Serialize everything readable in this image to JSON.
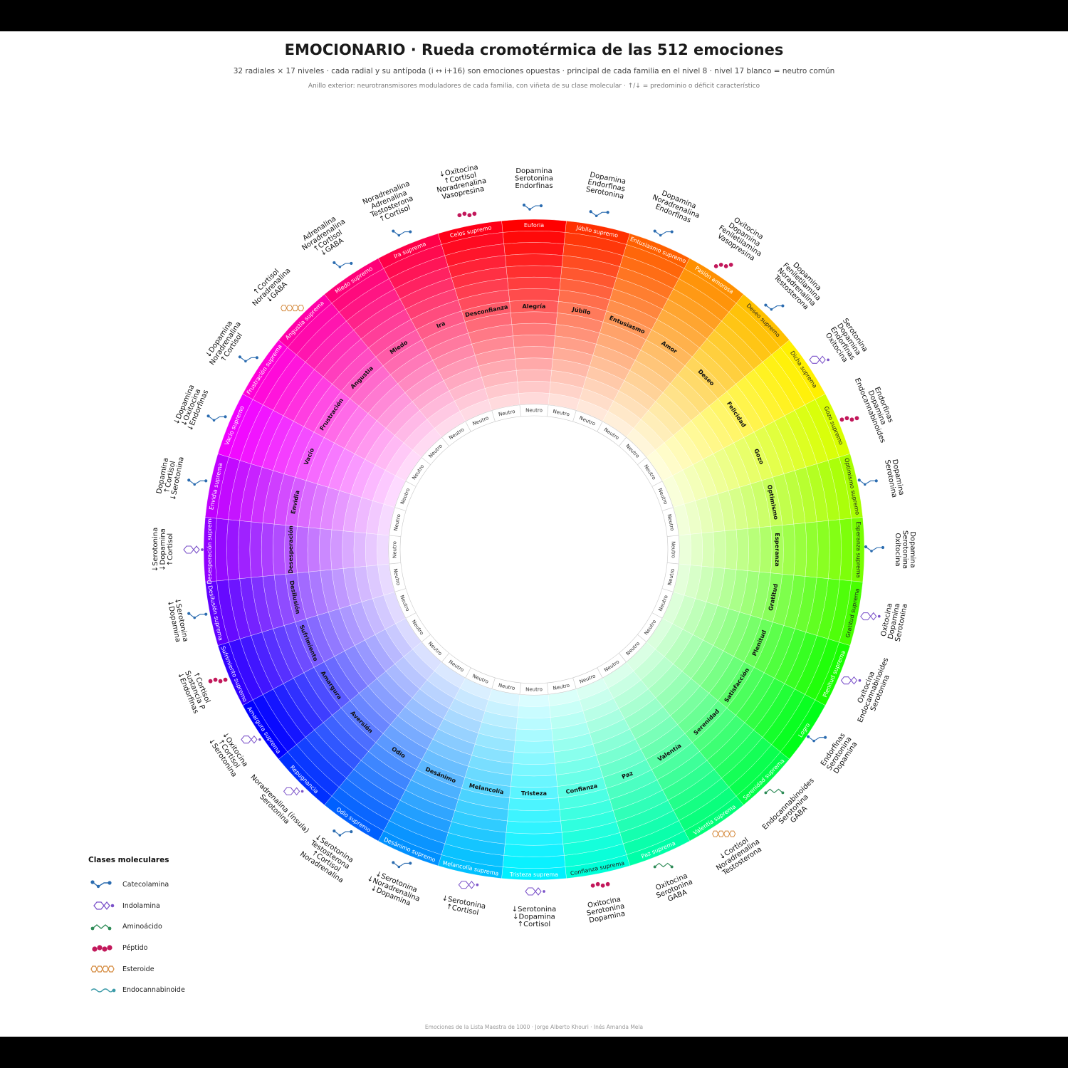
{
  "header": {
    "title": "EMOCIONARIO · Rueda cromotérmica de las 512 emociones",
    "subtitle": "32 radiales × 17 niveles · cada radial y su antípoda (i ↔ i+16) son emociones opuestas · principal de cada familia en el nivel 8 · nivel 17 blanco = neutro común",
    "note": "Anillo exterior: neurotransmisores moduladores de cada familia, con viñeta de su clase molecular · ↑/↓ = predominio o déficit característico"
  },
  "wheel": {
    "families": [
      {
        "principal": "Alegría",
        "outer": "Euforia",
        "inner": "Neutro",
        "color": "#ff0000",
        "neuro": [
          "Endorfinas",
          "Serotonina",
          "Dopamina"
        ],
        "cls": "catecolamina"
      },
      {
        "principal": "Júbilo",
        "outer": "Júbilo supremo",
        "inner": "Neutro",
        "color": "#ff3000",
        "neuro": [
          "Serotonina",
          "Endorfinas",
          "Dopamina"
        ],
        "cls": "catecolamina"
      },
      {
        "principal": "Entusiasmo",
        "outer": "Entusiasmo supremo",
        "inner": "Neutro",
        "color": "#ff6000",
        "neuro": [
          "Endorfinas",
          "Noradrenalina",
          "Dopamina"
        ],
        "cls": "catecolamina"
      },
      {
        "principal": "Amor",
        "outer": "Pasión amorosa",
        "inner": "Neutro",
        "color": "#ff9000",
        "neuro": [
          "Vasopresina",
          "Feniletilamina",
          "Dopamina",
          "Oxitocina"
        ],
        "cls": "peptido"
      },
      {
        "principal": "Deseo",
        "outer": "Deseo supremo",
        "inner": "Neutro",
        "color": "#ffc000",
        "neuro": [
          "Testosterona",
          "Noradrenalina",
          "Feniletilamina",
          "Dopamina"
        ],
        "cls": "catecolamina"
      },
      {
        "principal": "Felicidad",
        "outer": "Dicha suprema",
        "inner": "Neutro",
        "color": "#fff000",
        "neuro": [
          "Oxitocina",
          "Endorfinas",
          "Dopamina",
          "Serotonina"
        ],
        "cls": "indolamina"
      },
      {
        "principal": "Gozo",
        "outer": "Gozo supremo",
        "inner": "Neutro",
        "color": "#d8ff00",
        "neuro": [
          "Endocannabinoides",
          "Dopamina",
          "Endorfinas"
        ],
        "cls": "peptido"
      },
      {
        "principal": "Optimismo",
        "outer": "Optimismo supremo",
        "inner": "Neutro",
        "color": "#a8ff00",
        "neuro": [
          "Serotonina",
          "Dopamina"
        ],
        "cls": "catecolamina"
      },
      {
        "principal": "Esperanza",
        "outer": "Esperanza suprema",
        "inner": "Neutro",
        "color": "#78ff00",
        "neuro": [
          "Oxitocina",
          "Serotonina",
          "Dopamina"
        ],
        "cls": "catecolamina"
      },
      {
        "principal": "Gratitud",
        "outer": "Gratitud suprema",
        "inner": "Neutro",
        "color": "#48ff00",
        "neuro": [
          "Oxitocina",
          "Dopamina",
          "Serotonina"
        ],
        "cls": "indolamina"
      },
      {
        "principal": "Plenitud",
        "outer": "Plenitud suprema",
        "inner": "Neutro",
        "color": "#18ff00",
        "neuro": [
          "Oxitocina",
          "Endocannabinoides",
          "Serotonina"
        ],
        "cls": "indolamina"
      },
      {
        "principal": "Satisfacción",
        "outer": "Logro",
        "inner": "Neutro",
        "color": "#00ff18",
        "neuro": [
          "Endorfinas",
          "Serotonina",
          "Dopamina"
        ],
        "cls": "catecolamina"
      },
      {
        "principal": "Serenidad",
        "outer": "Serenidad suprema",
        "inner": "Neutro",
        "color": "#00ff48",
        "neuro": [
          "Endocannabinoides",
          "Serotonina",
          "GABA"
        ],
        "cls": "aminoacido"
      },
      {
        "principal": "Valentía",
        "outer": "Valentía suprema",
        "inner": "Neutro",
        "color": "#00ff78",
        "neuro": [
          "↓Cortisol",
          "Noradrenalina",
          "Testosterona"
        ],
        "cls": "esteroide"
      },
      {
        "principal": "Paz",
        "outer": "Paz suprema",
        "inner": "Neutro",
        "color": "#00ffa8",
        "neuro": [
          "Oxitocina",
          "Serotonina",
          "GABA"
        ],
        "cls": "aminoacido"
      },
      {
        "principal": "Confianza",
        "outer": "Confianza suprema",
        "inner": "Neutro",
        "color": "#00ffd8",
        "neuro": [
          "Oxitocina",
          "Serotonina",
          "Dopamina"
        ],
        "cls": "peptido"
      },
      {
        "principal": "Tristeza",
        "outer": "Tristeza suprema",
        "inner": "Neutro",
        "color": "#00f0ff",
        "neuro": [
          "↓Serotonina",
          "↓Dopamina",
          "↑Cortisol"
        ],
        "cls": "indolamina"
      },
      {
        "principal": "Melancolía",
        "outer": "Melancolía suprema",
        "inner": "Neutro",
        "color": "#00c0ff",
        "neuro": [
          "↓Serotonina",
          "↑Cortisol"
        ],
        "cls": "indolamina"
      },
      {
        "principal": "Desánimo",
        "outer": "Desánimo supremo",
        "inner": "Neutro",
        "color": "#0090ff",
        "neuro": [
          "↓Serotonina",
          "↓Noradrenalina",
          "↓Dopamina"
        ],
        "cls": "catecolamina"
      },
      {
        "principal": "Odio",
        "outer": "Odio supremo",
        "inner": "Neutro",
        "color": "#0060ff",
        "neuro": [
          "↓Serotonina",
          "Testosterona",
          "↑Cortisol",
          "Noradrenalina"
        ],
        "cls": "catecolamina"
      },
      {
        "principal": "Aversión",
        "outer": "Repugnancia",
        "inner": "Neutro",
        "color": "#0030ff",
        "neuro": [
          "Noradrenalina (ínsula)",
          "Serotonina"
        ],
        "cls": "indolamina"
      },
      {
        "principal": "Amargura",
        "outer": "Amargura suprema",
        "inner": "Neutro",
        "color": "#0000ff",
        "neuro": [
          "↓Oxitocina",
          "↑Cortisol",
          "↓Serotonina"
        ],
        "cls": "indolamina"
      },
      {
        "principal": "Sufrimiento",
        "outer": "Sufrimiento supremo",
        "inner": "Neutro",
        "color": "#3000ff",
        "neuro": [
          "↑Cortisol",
          "Sustancia P",
          "↓Endorfinas"
        ],
        "cls": "peptido"
      },
      {
        "principal": "Desilusión",
        "outer": "Desilusión suprema",
        "inner": "Neutro",
        "color": "#6000ff",
        "neuro": [
          "↓Serotonina",
          "↓Dopamina"
        ],
        "cls": "catecolamina"
      },
      {
        "principal": "Desesperación",
        "outer": "Desesperación suprema",
        "inner": "Neutro",
        "color": "#9000ff",
        "neuro": [
          "↑Cortisol",
          "↓Dopamina",
          "↓Serotonina"
        ],
        "cls": "indolamina"
      },
      {
        "principal": "Envidia",
        "outer": "Envidia suprema",
        "inner": "Neutro",
        "color": "#c000ff",
        "neuro": [
          "↓Serotonina",
          "↑Cortisol",
          "Dopamina"
        ],
        "cls": "catecolamina"
      },
      {
        "principal": "Vacío",
        "outer": "Vacío supremo",
        "inner": "Neutro",
        "color": "#f000ff",
        "neuro": [
          "↓Endorfinas",
          "↓Oxitocina",
          "↓Dopamina"
        ],
        "cls": "catecolamina"
      },
      {
        "principal": "Frustración",
        "outer": "Frustración suprema",
        "inner": "Neutro",
        "color": "#ff00d8",
        "neuro": [
          "↑Cortisol",
          "Noradrenalina",
          "↓Dopamina"
        ],
        "cls": "catecolamina"
      },
      {
        "principal": "Angustia",
        "outer": "Angustia suprema",
        "inner": "Neutro",
        "color": "#ff00a8",
        "neuro": [
          "↓GABA",
          "Noradrenalina",
          "↑Cortisol"
        ],
        "cls": "esteroide"
      },
      {
        "principal": "Miedo",
        "outer": "Miedo supremo",
        "inner": "Neutro",
        "color": "#ff0078",
        "neuro": [
          "↓GABA",
          "↑Cortisol",
          "Noradrenalina",
          "Adrenalina"
        ],
        "cls": "catecolamina"
      },
      {
        "principal": "Ira",
        "outer": "Ira suprema",
        "inner": "Neutro",
        "color": "#ff0048",
        "neuro": [
          "↑Cortisol",
          "Testosterona",
          "Adrenalina",
          "Noradrenalina"
        ],
        "cls": "catecolamina"
      },
      {
        "principal": "Desconfianza",
        "outer": "Celos supremo",
        "inner": "Neutro",
        "color": "#ff0018",
        "neuro": [
          "Vasopresina",
          "Noradrenalina",
          "↑Cortisol",
          "↓Oxitocina"
        ],
        "cls": "peptido"
      }
    ]
  },
  "legend": {
    "title": "Clases moleculares",
    "items": [
      {
        "key": "catecolamina",
        "label": "Catecolamina",
        "color": "#2b6cb0"
      },
      {
        "key": "indolamina",
        "label": "Indolamina",
        "color": "#7b52c9"
      },
      {
        "key": "aminoacido",
        "label": "Aminoácido",
        "color": "#2e8b57"
      },
      {
        "key": "peptido",
        "label": "Péptido",
        "color": "#c2185b"
      },
      {
        "key": "esteroide",
        "label": "Esteroide",
        "color": "#d4883a"
      },
      {
        "key": "endocannabinoide",
        "label": "Endocannabinoide",
        "color": "#3a9aa8"
      }
    ]
  },
  "footer": "Emociones de la Lista Maestra de 1000 · Jorge Alberto Khouri · Inés Amanda Mela"
}
